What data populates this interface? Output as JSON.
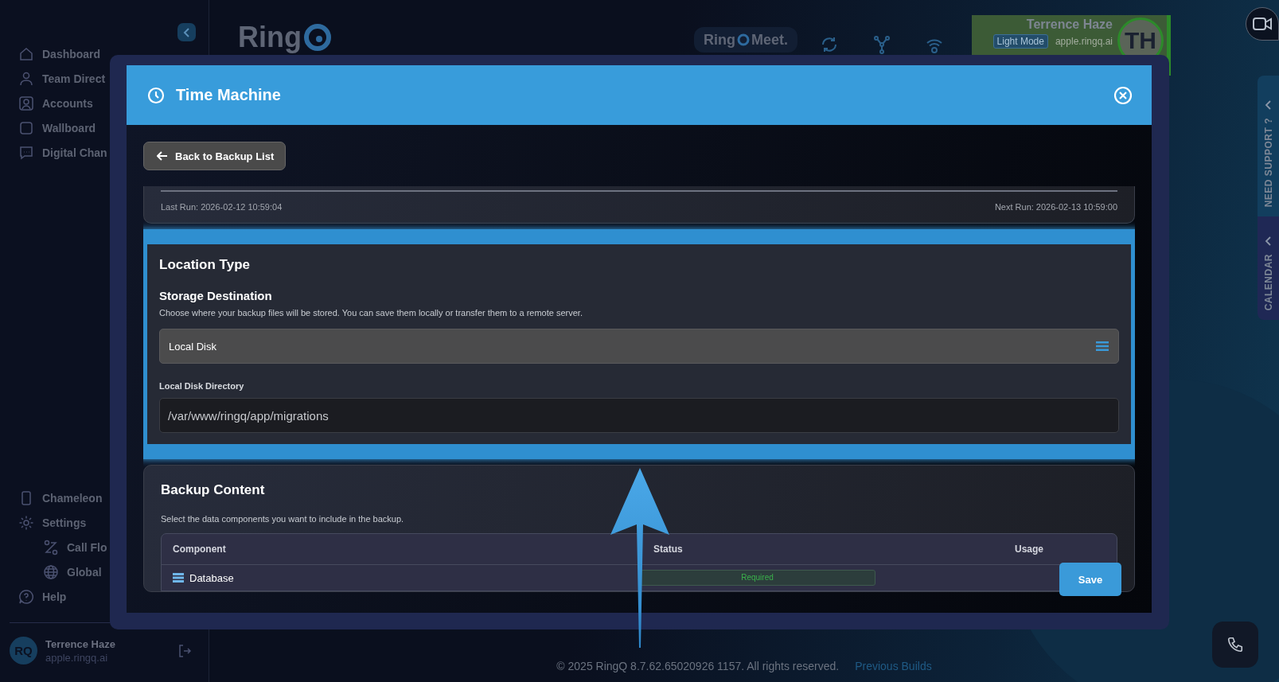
{
  "sidebar": {
    "items": [
      {
        "label": "Dashboard"
      },
      {
        "label": "Team Direct"
      },
      {
        "label": "Accounts"
      },
      {
        "label": "Wallboard"
      },
      {
        "label": "Digital Chan"
      }
    ],
    "bottom_items": [
      {
        "label": "Chameleon"
      },
      {
        "label": "Settings",
        "children": [
          {
            "label": "Call Flo"
          },
          {
            "label": "Global"
          }
        ]
      },
      {
        "label": "Help"
      }
    ],
    "user": {
      "avatar_text": "RQ",
      "name": "Terrence Haze",
      "domain": "apple.ringq.ai"
    }
  },
  "header": {
    "logo": "Ring",
    "meet_logo": {
      "left": "Ring",
      "right": "Meet."
    },
    "profile": {
      "name": "Terrence Haze",
      "mode_button": "Light Mode",
      "domain": "apple.ringq.ai",
      "initials": "TH"
    }
  },
  "side_tabs": [
    {
      "label": "NEED SUPPORT ?"
    },
    {
      "label": "CALENDAR"
    }
  ],
  "modal": {
    "title": "Time Machine",
    "back_button": "Back to Backup List",
    "schedule": {
      "last_run": "Last Run: 2026-02-12 10:59:04",
      "next_run": "Next Run: 2026-02-13 10:59:00"
    },
    "location": {
      "title": "Location Type",
      "subtitle": "Storage Destination",
      "description": "Choose where your backup files will be stored. You can save them locally or transfer them to a remote server.",
      "select_value": "Local Disk",
      "directory_label": "Local Disk Directory",
      "directory_value": "/var/www/ringq/app/migrations"
    },
    "backup_content": {
      "title": "Backup Content",
      "description": "Select the data components you want to include in the backup.",
      "columns": [
        "Component",
        "Status",
        "Usage"
      ],
      "rows": [
        {
          "component": "Database",
          "status": "Required"
        }
      ]
    },
    "save_button": "Save"
  },
  "footer": {
    "copyright": "© 2025 RingQ 8.7.62.65020926 1157. All rights reserved.",
    "link": "Previous Builds"
  }
}
